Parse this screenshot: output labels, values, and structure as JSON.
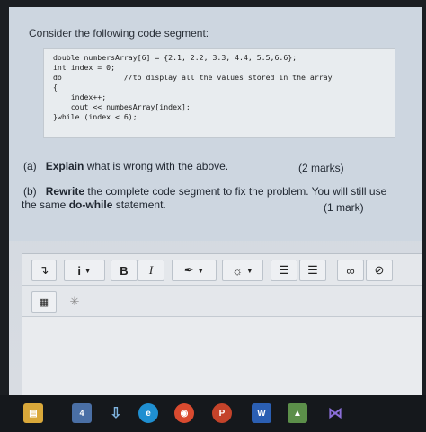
{
  "question": {
    "prompt": "Consider the following code segment:",
    "code_lines": [
      "double numbersArray[6] = {2.1, 2.2, 3.3, 4.4, 5.5,6.6};",
      "int index = 0;",
      "do              //to display all the values stored in the array",
      "{",
      "    index++;",
      "    cout << numbesArray[index];",
      "}while (index < 6);"
    ],
    "part_a_letter": "(a)",
    "part_a_bold": "Explain",
    "part_a_rest": "what is wrong with the above.",
    "part_a_marks": "(2 marks)",
    "part_b_letter": "(b)",
    "part_b_bold": "Rewrite",
    "part_b_rest": "the complete code segment to fix the problem. You will still use",
    "part_b_line2_pre": "the same",
    "part_b_line2_bold": "do-while",
    "part_b_line2_post": "statement.",
    "part_b_marks": "(1 mark)"
  },
  "toolbar": {
    "paragraph_icon": "paragraph-style-icon",
    "info_label": "i",
    "bold_label": "B",
    "italic_label": "I",
    "bullets_icon": "bullet-list-icon",
    "numbered_icon": "numbered-list-icon",
    "link_icon": "link-icon",
    "unlink_icon": "unlink-icon",
    "image_icon": "image-icon",
    "media_icon": "media-icon"
  },
  "taskbar": {
    "badge_count": "4",
    "apps": [
      "file-explorer",
      "mail",
      "download",
      "edge",
      "chrome",
      "powerpoint",
      "word",
      "app",
      "visual-studio"
    ]
  }
}
